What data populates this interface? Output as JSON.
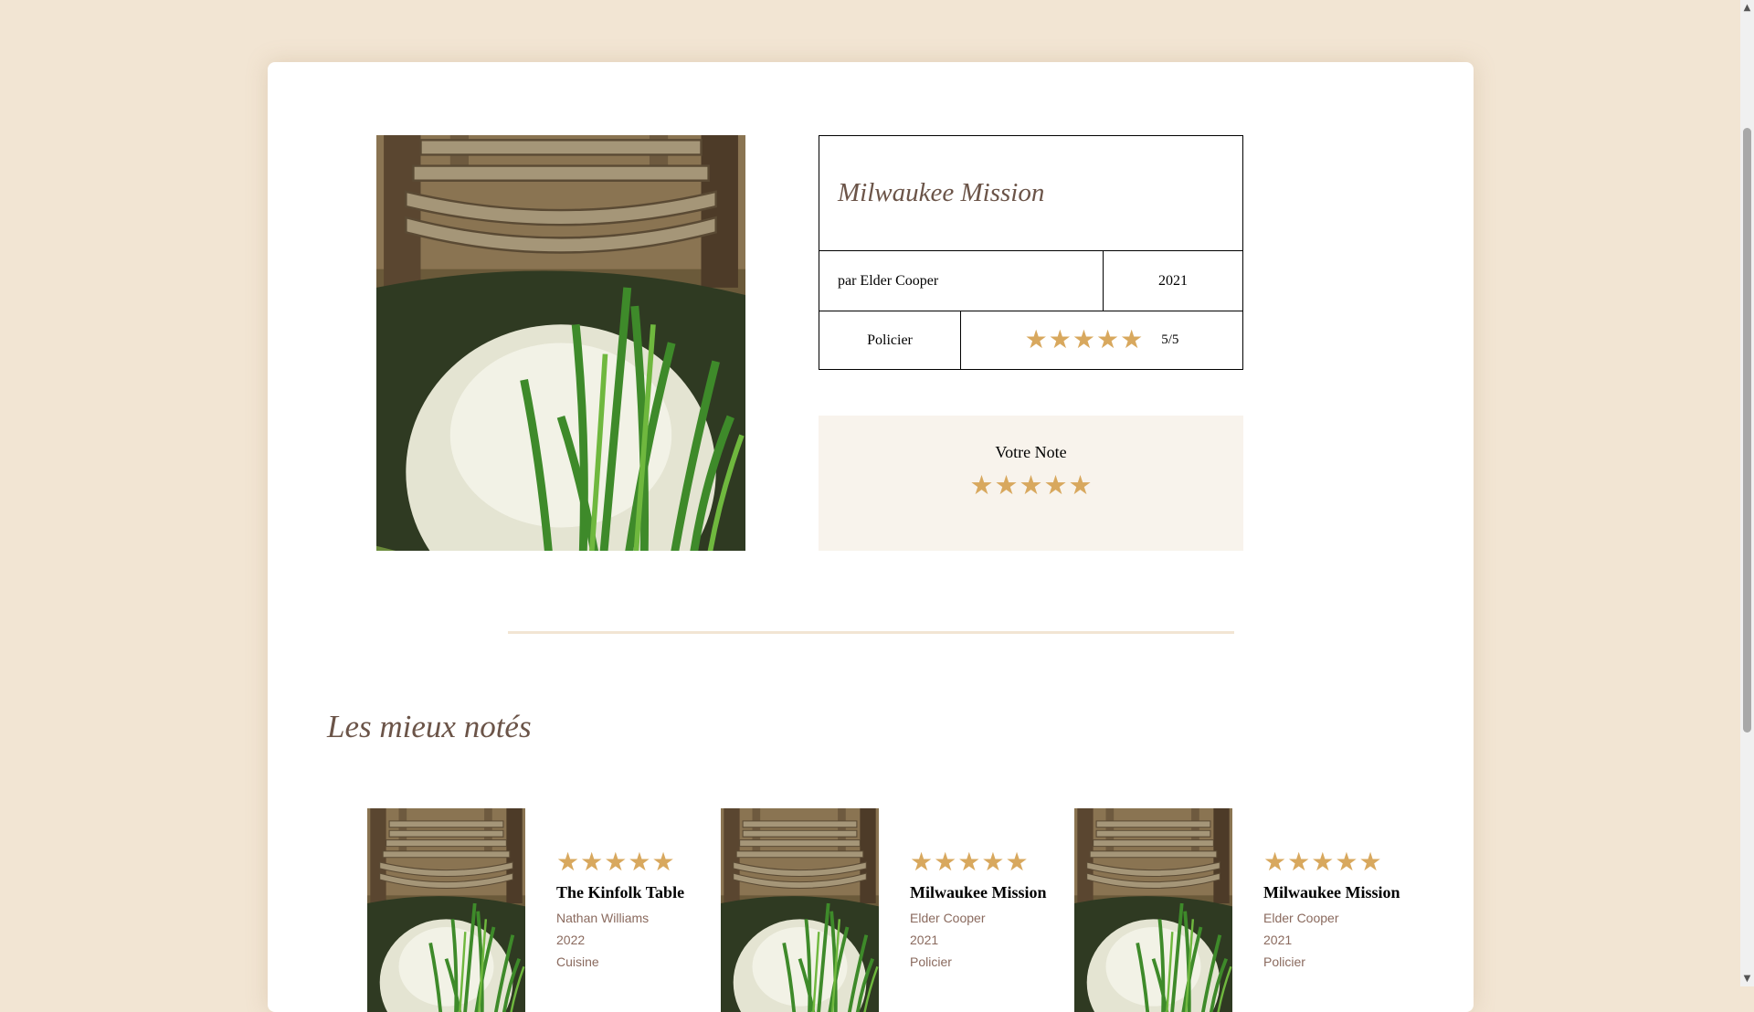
{
  "book": {
    "title": "Milwaukee Mission",
    "author_line": "par Elder Cooper",
    "year": "2021",
    "genre": "Policier",
    "rating": 5,
    "rating_text": "5/5",
    "cover_icon": "dock-pond-photo"
  },
  "your_note": {
    "label": "Votre Note",
    "rating": 5
  },
  "top_rated": {
    "heading": "Les mieux notés",
    "items": [
      {
        "title": "The Kinfolk Table",
        "author": "Nathan Williams",
        "year": "2022",
        "genre": "Cuisine",
        "rating": 5
      },
      {
        "title": "Milwaukee Mission",
        "author": "Elder Cooper",
        "year": "2021",
        "genre": "Policier",
        "rating": 5
      },
      {
        "title": "Milwaukee Mission",
        "author": "Elder Cooper",
        "year": "2021",
        "genre": "Policier",
        "rating": 5
      }
    ]
  },
  "colors": {
    "page_bg": "#f2e5d3",
    "accent_star": "#d8a85e",
    "title_text": "#6b5448",
    "note_bg": "#f8f3ec"
  },
  "icons": {
    "star": "star-icon",
    "scroll_up": "scroll-up-arrow-icon",
    "scroll_down": "scroll-down-arrow-icon"
  }
}
